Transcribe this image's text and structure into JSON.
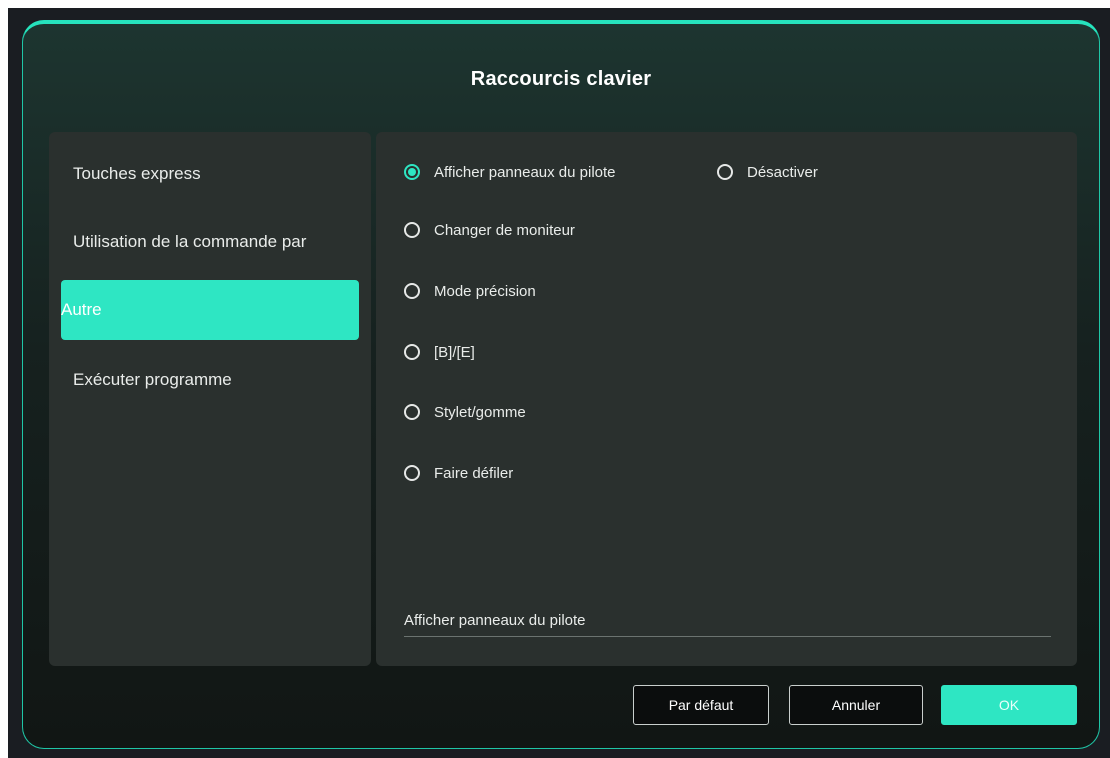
{
  "dialog": {
    "title": "Raccourcis clavier"
  },
  "sidebar": {
    "items": [
      {
        "label": "Touches express",
        "active": false
      },
      {
        "label": "Utilisation de la commande par",
        "active": false
      },
      {
        "label": "Autre",
        "active": true
      },
      {
        "label": "Exécuter programme",
        "active": false
      }
    ]
  },
  "options": {
    "selected": "Afficher panneaux du pilote",
    "items": [
      {
        "label": "Afficher panneaux du pilote",
        "checked": true
      },
      {
        "label": "Désactiver",
        "checked": false
      },
      {
        "label": "Changer de moniteur",
        "checked": false
      },
      {
        "label": "Mode précision",
        "checked": false
      },
      {
        "label": "[B]/[E]",
        "checked": false
      },
      {
        "label": "Stylet/gomme",
        "checked": false
      },
      {
        "label": "Faire défiler",
        "checked": false
      }
    ]
  },
  "description": {
    "value": "Afficher panneaux du pilote"
  },
  "footer": {
    "default_label": "Par défaut",
    "cancel_label": "Annuler",
    "ok_label": "OK"
  },
  "colors": {
    "accent": "#2ee6c3",
    "panel": "#2a302e",
    "border_glow": "#26e3bd"
  }
}
